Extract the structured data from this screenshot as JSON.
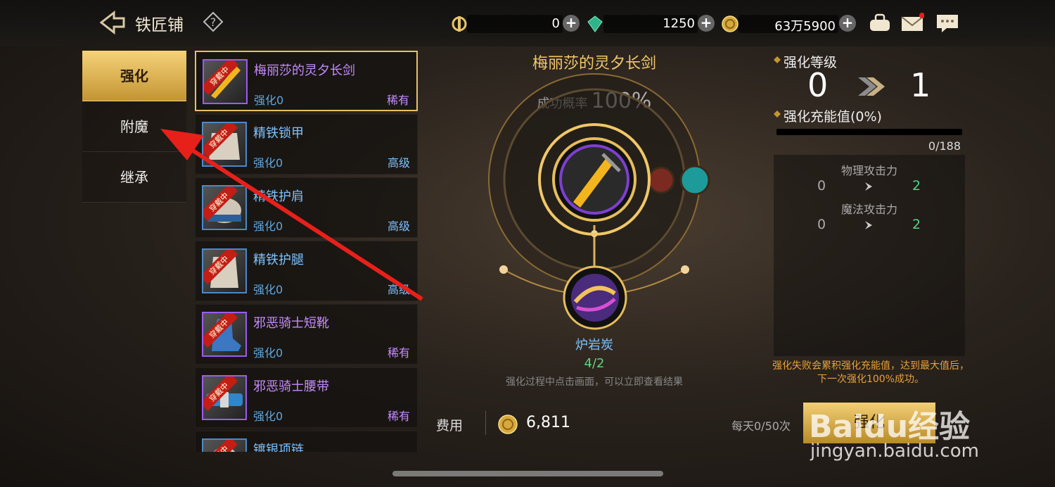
{
  "header": {
    "title": "铁匠铺",
    "currencies": [
      {
        "icon": "token-icon",
        "value": "0"
      },
      {
        "icon": "gem-icon",
        "value": "1250"
      },
      {
        "icon": "gold-coin-icon",
        "value": "63万5900"
      }
    ]
  },
  "tabs": [
    {
      "label": "强化",
      "active": true
    },
    {
      "label": "附魔",
      "active": false
    },
    {
      "label": "继承",
      "active": false
    }
  ],
  "items": [
    {
      "name": "梅丽莎的灵夕长剑",
      "level": "强化0",
      "grade": "稀有",
      "tier": "rare",
      "wear": "穿戴中"
    },
    {
      "name": "精铁锁甲",
      "level": "强化0",
      "grade": "高级",
      "tier": "high",
      "wear": "穿戴中"
    },
    {
      "name": "精铁护肩",
      "level": "强化0",
      "grade": "高级",
      "tier": "high",
      "wear": "穿戴中"
    },
    {
      "name": "精铁护腿",
      "level": "强化0",
      "grade": "高级",
      "tier": "high",
      "wear": "穿戴中"
    },
    {
      "name": "邪恶骑士短靴",
      "level": "强化0",
      "grade": "稀有",
      "tier": "rare",
      "wear": "穿戴中"
    },
    {
      "name": "邪恶骑士腰带",
      "level": "强化0",
      "grade": "稀有",
      "tier": "rare",
      "wear": "穿戴中"
    },
    {
      "name": "镀银项链",
      "level": "",
      "grade": "",
      "tier": "high",
      "wear": "穿戴中"
    }
  ],
  "center": {
    "item_name": "梅丽莎的灵夕长剑",
    "rate_label": "成功概率",
    "rate_value": "100%",
    "material_name": "炉岩炭",
    "material_count": "4/2",
    "hint": "强化过程中点击画面，可以立即查看结果"
  },
  "right": {
    "level_label": "强化等级",
    "level_from": "0",
    "level_to": "1",
    "charge_label": "强化充能值(0%)",
    "charge_progress": 0,
    "charge_count": "0/188",
    "stats": [
      {
        "name": "物理攻击力",
        "from": "0",
        "to": "2"
      },
      {
        "name": "魔法攻击力",
        "from": "0",
        "to": "2"
      }
    ],
    "note": "强化失败会累积强化充能值，达到最大值后，下一次强化100%成功。"
  },
  "footer": {
    "cost_label": "费用",
    "cost_value": "6,811",
    "daily": "每天0/50次",
    "enhance_label": "强化"
  },
  "watermark": {
    "logo": "Baidu经验",
    "url": "jingyan.baidu.com"
  }
}
